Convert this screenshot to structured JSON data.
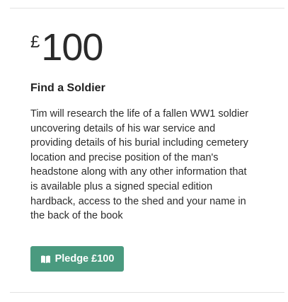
{
  "reward": {
    "currency_symbol": "£",
    "amount": "100",
    "title": "Find a Soldier",
    "description": "Tim will research the life of a fallen WW1 soldier uncovering details of his war service and providing details of his burial including cemetery location and precise position of the man's headstone along with any other information that is available plus a signed special edition hardback, access to the shed and your name in the back of the book",
    "pledge_button_label": "Pledge £100",
    "pledge_button_icon": "book-icon"
  },
  "colors": {
    "button_background": "#4a9a7f",
    "button_text": "#ffffff",
    "divider": "#e3e3e3"
  }
}
